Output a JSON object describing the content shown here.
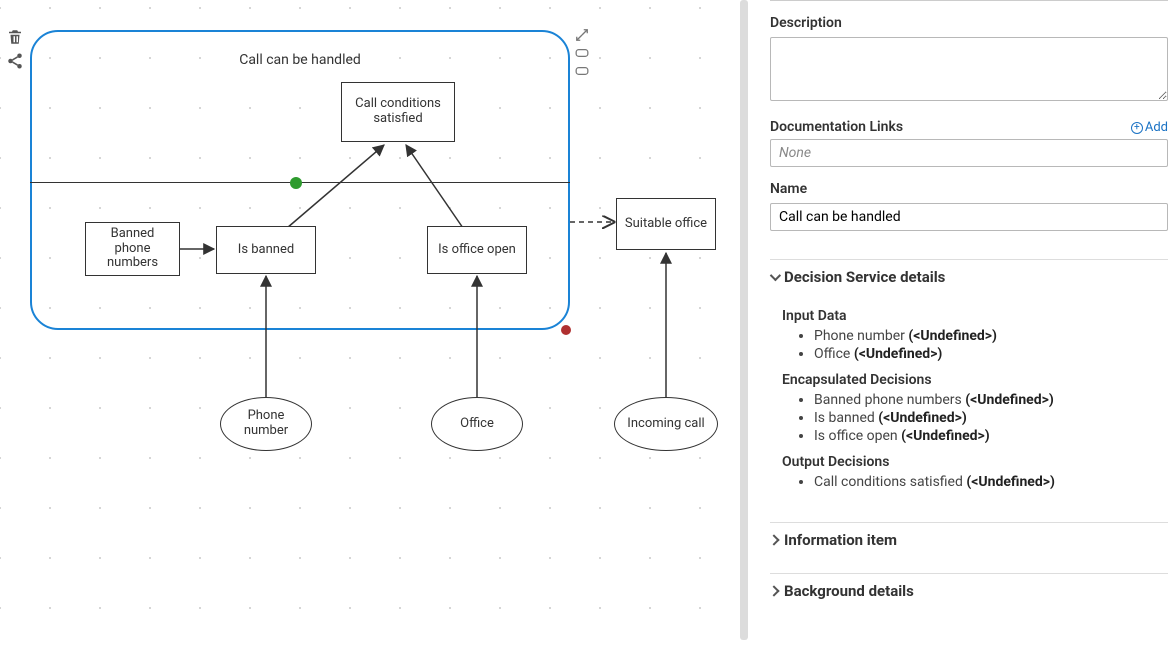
{
  "side": {
    "description_label": "Description",
    "description_value": "",
    "doc_links_label": "Documentation Links",
    "doc_links_placeholder": "None",
    "add_label": "Add",
    "name_label": "Name",
    "name_value": "Call can be handled",
    "section_decision": "Decision Service details",
    "input_data_h": "Input Data",
    "input_data": [
      {
        "name": "Phone number",
        "type": "(<Undefined>)"
      },
      {
        "name": "Office",
        "type": "(<Undefined>)"
      }
    ],
    "encaps_h": "Encapsulated Decisions",
    "encaps": [
      {
        "name": "Banned phone numbers",
        "type": "(<Undefined>)"
      },
      {
        "name": "Is banned",
        "type": "(<Undefined>)"
      },
      {
        "name": "Is office open",
        "type": "(<Undefined>)"
      }
    ],
    "output_h": "Output Decisions",
    "output": [
      {
        "name": "Call conditions satisfied",
        "type": "(<Undefined>)"
      }
    ],
    "section_info": "Information item",
    "section_bg": "Background details"
  },
  "diagram": {
    "group_title": "Call can be handled",
    "call_conditions": "Call conditions\nsatisfied",
    "banned_numbers": "Banned\nphone\nnumbers",
    "is_banned": "Is banned",
    "is_office_open": "Is office open",
    "suitable_office": "Suitable office",
    "phone_number": "Phone\nnumber",
    "office": "Office",
    "incoming_call": "Incoming call"
  },
  "chart_data": {
    "type": "diagram",
    "diagram_kind": "DMN Decision Service",
    "title": "Call can be handled",
    "nodes": [
      {
        "id": "svc",
        "kind": "decision-service",
        "label": "Call can be handled"
      },
      {
        "id": "cc",
        "kind": "decision",
        "label": "Call conditions satisfied",
        "section": "output"
      },
      {
        "id": "bpn",
        "kind": "decision",
        "label": "Banned phone numbers",
        "section": "encapsulated"
      },
      {
        "id": "ib",
        "kind": "decision",
        "label": "Is banned",
        "section": "encapsulated"
      },
      {
        "id": "ioo",
        "kind": "decision",
        "label": "Is office open",
        "section": "encapsulated"
      },
      {
        "id": "so",
        "kind": "decision",
        "label": "Suitable office",
        "section": "external"
      },
      {
        "id": "pn",
        "kind": "input-data",
        "label": "Phone number"
      },
      {
        "id": "off",
        "kind": "input-data",
        "label": "Office"
      },
      {
        "id": "inc",
        "kind": "input-data",
        "label": "Incoming call"
      }
    ],
    "edges": [
      {
        "from": "bpn",
        "to": "ib",
        "style": "solid"
      },
      {
        "from": "ib",
        "to": "cc",
        "style": "solid"
      },
      {
        "from": "ioo",
        "to": "cc",
        "style": "solid"
      },
      {
        "from": "pn",
        "to": "ib",
        "style": "solid"
      },
      {
        "from": "off",
        "to": "ioo",
        "style": "solid"
      },
      {
        "from": "inc",
        "to": "so",
        "style": "solid"
      },
      {
        "from": "svc",
        "to": "so",
        "style": "dashed"
      }
    ]
  }
}
